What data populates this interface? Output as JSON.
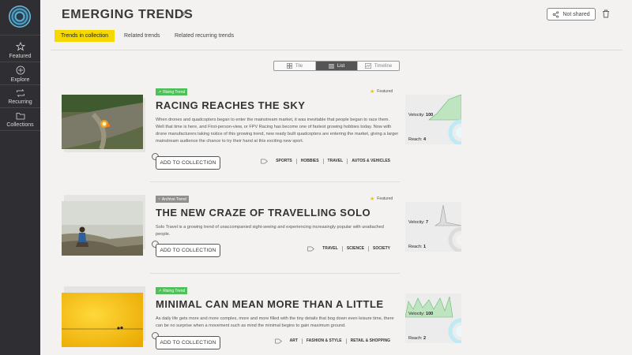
{
  "sidebar": {
    "items": [
      {
        "label": "Featured",
        "icon": "star-icon"
      },
      {
        "label": "Explore",
        "icon": "compass-icon"
      },
      {
        "label": "Recurring",
        "icon": "repeat-icon"
      },
      {
        "label": "Collections",
        "icon": "folder-icon"
      }
    ]
  },
  "header": {
    "title": "EMERGING TRENDS",
    "share_label": "Not shared"
  },
  "tabs": [
    {
      "label": "Trends in collection",
      "active": true
    },
    {
      "label": "Related trends",
      "active": false
    },
    {
      "label": "Related recurring trends",
      "active": false
    }
  ],
  "view_switcher": {
    "options": [
      {
        "label": "Tile",
        "active": false
      },
      {
        "label": "List",
        "active": true
      },
      {
        "label": "Timeline",
        "active": false
      }
    ]
  },
  "trends": [
    {
      "badge": "Rising Trend",
      "badge_type": "rising",
      "featured_label": "Featured",
      "title": "RACING REACHES THE SKY",
      "description": "When drones and quadcopters began to enter the mainstream market, it was inevitable that people began to race them. Well that time is here, and First-person-view, or FPV Racing has become one of fastest growing hobbies today. Now with drone manufacturers taking notice of this growing trend, new ready built quadcopters are entering the market, giving a larger mainstream audience the chance to try their hand at this exciting new sport.",
      "button": "ADD TO COLLECTION",
      "categories": [
        "SPORTS",
        "HOBBIES",
        "TRAVEL",
        "AUTOS & VEHICLES"
      ],
      "velocity_label": "Velocity:",
      "velocity": "100",
      "reach_label": "Reach:",
      "reach": "4"
    },
    {
      "badge": "Archive Trend",
      "badge_type": "archive",
      "featured_label": "Featured",
      "title": "THE NEW CRAZE OF TRAVELLING SOLO",
      "description": "Solo Travel is a growing trend of unaccompanied sight-seeing and experiencing increasingly popular with unattached people.",
      "button": "ADD TO COLLECTION",
      "categories": [
        "TRAVEL",
        "SCIENCE",
        "SOCIETY"
      ],
      "velocity_label": "Velocity:",
      "velocity": "7",
      "reach_label": "Reach:",
      "reach": "1"
    },
    {
      "badge": "Rising Trend",
      "badge_type": "rising",
      "title": "MINIMAL CAN MEAN MORE THAN A LITTLE",
      "description": "As daily life gets more and more complex, more and more filled with the tiny details that bog down even leisure time, there can be no surprise when a movement such as mind the minimal begins to gain maximum ground.",
      "button": "ADD TO COLLECTION",
      "categories": [
        "ART",
        "FASHION & STYLE",
        "RETAIL & SHOPPING"
      ],
      "velocity_label": "Velocity:",
      "velocity": "100",
      "reach_label": "Reach:",
      "reach": "2"
    }
  ],
  "colors": {
    "sidebar_bg": "#2f2f33",
    "accent_yellow": "#f5d800",
    "rising_green": "#4fbf5a",
    "archive_gray": "#8f8f8f"
  }
}
